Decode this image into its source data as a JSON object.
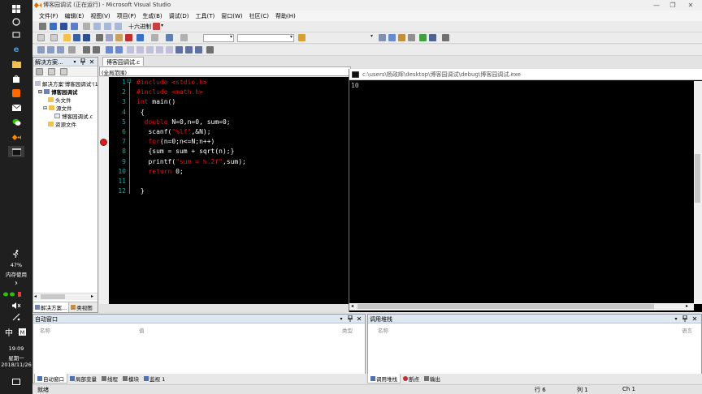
{
  "window": {
    "title": "博客园调试 (正在运行) - Microsoft Visual Studio",
    "min_glyph": "—",
    "restore_glyph": "❐",
    "close_glyph": "✕"
  },
  "menu": [
    "文件(F)",
    "编辑(E)",
    "视图(V)",
    "项目(P)",
    "生成(B)",
    "调试(D)",
    "工具(T)",
    "窗口(W)",
    "社区(C)",
    "帮助(H)"
  ],
  "toolbar": {
    "hex_label": "十六进制"
  },
  "solution_explorer": {
    "title": "解决方案...",
    "tree": [
      {
        "label": "解决方案'博客园调试'(1",
        "indent": 0
      },
      {
        "label": "博客园调试",
        "indent": 1
      },
      {
        "label": "头文件",
        "indent": 2
      },
      {
        "label": "源文件",
        "indent": 2
      },
      {
        "label": "博客园调试.c",
        "indent": 3
      },
      {
        "label": "资源文件",
        "indent": 2
      }
    ],
    "tabs": [
      "解决方案...",
      "类视图"
    ]
  },
  "editor": {
    "tab_label": "博客园调试.c",
    "scope": "(全局范围)",
    "lines": [
      {
        "n": "1",
        "parts": [
          {
            "t": "#include <stdio.h>",
            "c": "kw"
          }
        ]
      },
      {
        "n": "2",
        "parts": [
          {
            "t": "#include <math.h>",
            "c": "kw"
          }
        ]
      },
      {
        "n": "3",
        "parts": [
          {
            "t": "int",
            "c": "kw"
          },
          {
            "t": " main()",
            "c": ""
          }
        ]
      },
      {
        "n": "4",
        "parts": [
          {
            "t": " {",
            "c": ""
          }
        ]
      },
      {
        "n": "5",
        "parts": [
          {
            "t": "  double",
            "c": "kw"
          },
          {
            "t": " N=0,n=0, sum=0;",
            "c": ""
          }
        ]
      },
      {
        "n": "6",
        "parts": [
          {
            "t": "   scanf(",
            "c": ""
          },
          {
            "t": "\"%lf\"",
            "c": "str"
          },
          {
            "t": ",&N);",
            "c": ""
          }
        ]
      },
      {
        "n": "7",
        "parts": [
          {
            "t": "   for",
            "c": "kw"
          },
          {
            "t": "(n=0;n<=N;n++)",
            "c": ""
          }
        ]
      },
      {
        "n": "8",
        "parts": [
          {
            "t": "   {sum = sum + sqrt(n);}",
            "c": ""
          }
        ]
      },
      {
        "n": "9",
        "parts": [
          {
            "t": "   printf(",
            "c": ""
          },
          {
            "t": "\"sum = %.2f\"",
            "c": "str"
          },
          {
            "t": ",sum);",
            "c": ""
          }
        ]
      },
      {
        "n": "10",
        "parts": [
          {
            "t": "   return",
            "c": "kw"
          },
          {
            "t": " 0;",
            "c": ""
          }
        ]
      },
      {
        "n": "11",
        "parts": [
          {
            "t": "",
            "c": ""
          }
        ]
      },
      {
        "n": "12",
        "parts": [
          {
            "t": " }",
            "c": ""
          }
        ]
      }
    ]
  },
  "console": {
    "path": "c:\\users\\杨政辉\\desktop\\博客园调试\\debug\\博客园调试.exe",
    "output": "10"
  },
  "auto_window": {
    "title": "自动窗口",
    "columns": [
      "名称",
      "值",
      "类型"
    ],
    "tabs": [
      "自动窗口",
      "局部变量",
      "线程",
      "模块",
      "监视 1"
    ]
  },
  "call_stack": {
    "title": "调用堆栈",
    "columns": [
      "名称",
      "语言"
    ],
    "tabs": [
      "调用堆栈",
      "断点",
      "输出"
    ]
  },
  "status": {
    "ready": "就绪",
    "row": "行 6",
    "col": "列 1",
    "ch": "Ch 1"
  },
  "taskbar": {
    "battery_percent": "47%",
    "memory_label": "内存使用",
    "time": "19:09",
    "weekday": "星期一",
    "date": "2018/11/26",
    "ime": "中"
  },
  "colors": {
    "keyword": "#e01010",
    "line_number": "#00b3b3",
    "breakpoint": "#d62020"
  }
}
